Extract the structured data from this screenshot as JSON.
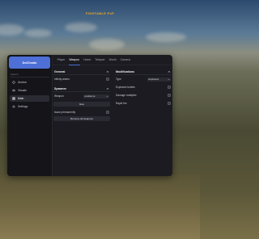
{
  "game_title": "FIGHTABLE PvP",
  "menu": {
    "brand": "DoCheats",
    "search_placeholder": "Search",
    "sidebar": [
      {
        "label": "Aimbot",
        "icon": "crosshair-icon",
        "active": false
      },
      {
        "label": "Visuals",
        "icon": "eye-icon",
        "active": false
      },
      {
        "label": "Main",
        "icon": "grid-icon",
        "active": true
      },
      {
        "label": "Settings",
        "icon": "gear-icon",
        "active": false
      }
    ],
    "tabs": [
      "Player",
      "Weapon",
      "Home",
      "Teleport",
      "World",
      "Camera"
    ],
    "active_tab": "Weapon",
    "general": {
      "title": "General",
      "infinity_ammo_label": "Infinity ammo"
    },
    "spawner": {
      "title": "Spawner",
      "weapon_label": "Weapon",
      "weapon_value": "pewberve",
      "give_label": "Give",
      "issue_permanently_label": "Issue permanently",
      "remove_all_label": "Remove all weapons"
    },
    "modifications": {
      "title": "Modifications",
      "type_label": "Type",
      "type_value": "Explosive",
      "explosive_bullets_label": "Explosive bullets",
      "damage_multiplier_label": "Damage multiplier",
      "rapid_fire_label": "Rapid fire"
    }
  },
  "colors": {
    "accent": "#4d6fd6",
    "title": "#f2a81d",
    "panel": "#1b1b21",
    "sidebar": "#141419"
  }
}
